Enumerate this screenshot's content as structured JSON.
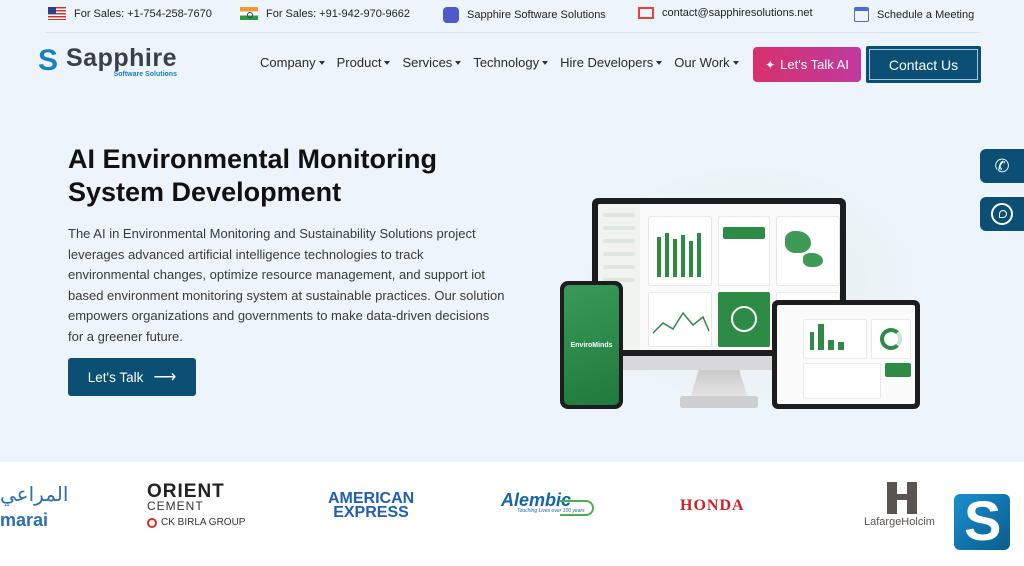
{
  "topbar": {
    "sales_us": "For Sales: +1-754-258-7670",
    "sales_in": "For Sales: +91-942-970-9662",
    "teams": "Sapphire Software Solutions",
    "email": "contact@sapphiresolutions.net",
    "meeting": "Schedule a Meeting"
  },
  "logo": {
    "name": "Sapphire",
    "sub": "Software Solutions"
  },
  "nav": {
    "items": [
      "Company",
      "Product",
      "Services",
      "Technology",
      "Hire Developers",
      "Our Work"
    ],
    "ai_button": "Let's Talk AI",
    "contact_button": "Contact Us"
  },
  "hero": {
    "title": "AI Environmental Monitoring System Development",
    "description": "The AI in Environmental Monitoring and Sustainability Solutions project leverages advanced artificial intelligence technologies to track environmental changes, optimize resource management, and support iot based environment monitoring system at sustainable practices. Our solution empowers organizations and governments to make data-driven decisions for a greener future.",
    "cta": "Let's Talk",
    "phone_app": "EnviroMinds"
  },
  "clients": {
    "almarai_ar": "المراعي",
    "almarai_en": "marai",
    "orient": "ORIENT",
    "orient_sub": "CEMENT",
    "ckbirla": "CK BIRLA GROUP",
    "amex_1": "AMERICAN",
    "amex_2": "EXPRESS",
    "alembic": "Alembic",
    "alembic_sub": "Touching Lives over 100 years",
    "honda": "HONDA",
    "lafarge": "LafargeHolcim"
  },
  "colors": {
    "primary": "#0b4f74",
    "accent_ai": "#d6316c",
    "background": "#eef4fc",
    "green": "#2e8b46"
  }
}
